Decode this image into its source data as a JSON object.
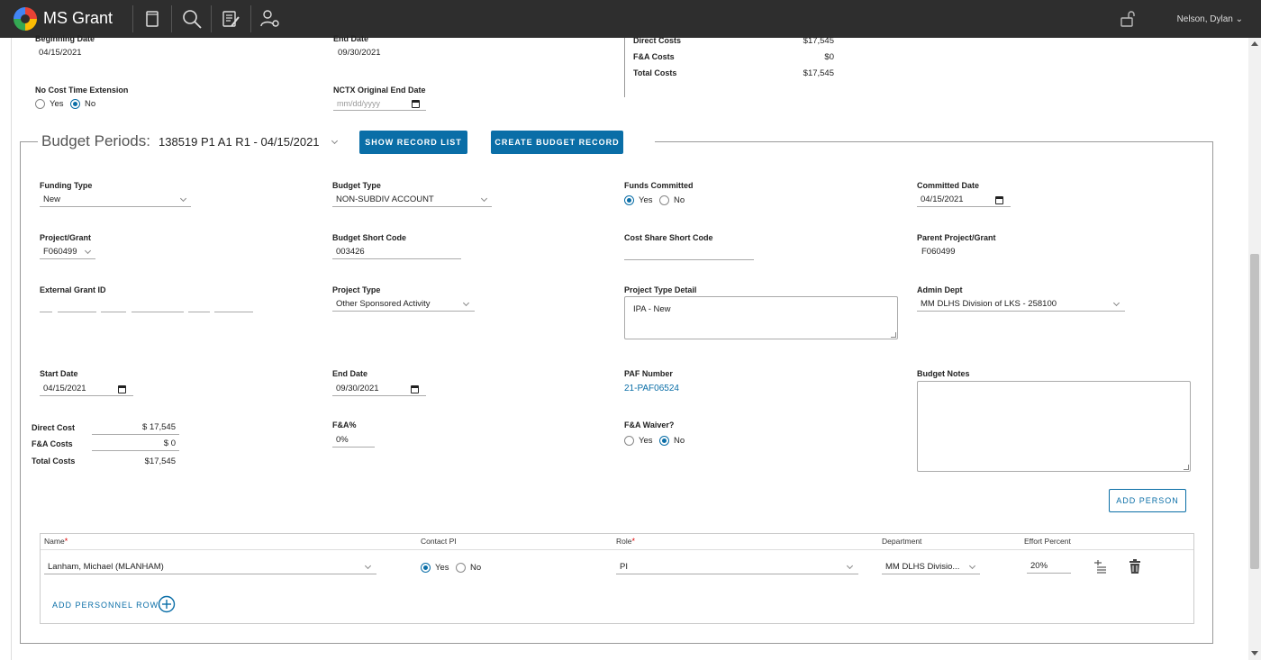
{
  "app": {
    "title": "MS Grant",
    "user": "Nelson, Dylan"
  },
  "icons": {
    "logo": "ms-grant-logo",
    "toolbar": [
      "document-icon",
      "search-icon",
      "edit-list-icon",
      "user-settings-icon"
    ],
    "lock": "unlock-icon"
  },
  "top_section": {
    "beginning_date_label": "Beginning Date",
    "beginning_date": "04/15/2021",
    "end_date_label": "End Date",
    "end_date": "09/30/2021",
    "no_cost_label": "No Cost Time Extension",
    "yes": "Yes",
    "no": "No",
    "nctx_label": "NCTX Original End Date",
    "nctx_placeholder": "mm/dd/yyyy",
    "costs": [
      {
        "label": "Direct Costs",
        "value": "$17,545"
      },
      {
        "label": "F&A Costs",
        "value": "$0"
      },
      {
        "label": "Total Costs",
        "value": "$17,545"
      }
    ]
  },
  "budget_periods": {
    "title": "Budget Periods:",
    "selected": "138519 P1 A1 R1 - 04/15/2021",
    "show_record_list": "SHOW RECORD LIST",
    "create_budget_record": "CREATE BUDGET RECORD"
  },
  "form": {
    "funding_type_label": "Funding Type",
    "funding_type": "New",
    "budget_type_label": "Budget Type",
    "budget_type": "NON-SUBDIV ACCOUNT",
    "funds_committed_label": "Funds Committed",
    "committed_date_label": "Committed Date",
    "committed_date": "04/15/2021",
    "project_grant_label": "Project/Grant",
    "project_grant": "F060499",
    "budget_short_code_label": "Budget Short Code",
    "budget_short_code": "003426",
    "cost_share_label": "Cost Share Short Code",
    "cost_share": "",
    "parent_label": "Parent Project/Grant",
    "parent": "F060499",
    "external_grant_label": "External Grant ID",
    "project_type_label": "Project Type",
    "project_type": "Other Sponsored Activity",
    "project_type_detail_label": "Project Type Detail",
    "project_type_detail": "IPA - New",
    "admin_dept_label": "Admin Dept",
    "admin_dept": "MM DLHS Division of LKS - 258100",
    "start_date_label": "Start Date",
    "start_date": "04/15/2021",
    "end_date_label": "End Date",
    "end_date": "09/30/2021",
    "paf_label": "PAF Number",
    "paf": "21-PAF06524",
    "budget_notes_label": "Budget Notes",
    "direct_cost_label": "Direct Cost",
    "direct_cost": "$ 17,545",
    "fa_costs_label": "F&A Costs",
    "fa_costs": "$ 0",
    "total_costs_label": "Total Costs",
    "total_costs": "$17,545",
    "fa_pct_label": "F&A%",
    "fa_pct": "0%",
    "fa_waiver_label": "F&A Waiver?",
    "add_person": "ADD PERSON"
  },
  "personnel": {
    "headers": {
      "name": "Name",
      "contact_pi": "Contact PI",
      "role": "Role",
      "department": "Department",
      "effort": "Effort Percent"
    },
    "rows": [
      {
        "name": "Lanham, Michael (MLANHAM)",
        "role": "PI",
        "department": "MM DLHS Divisio...",
        "effort": "20%"
      }
    ],
    "add_row": "ADD PERSONNEL ROW"
  }
}
